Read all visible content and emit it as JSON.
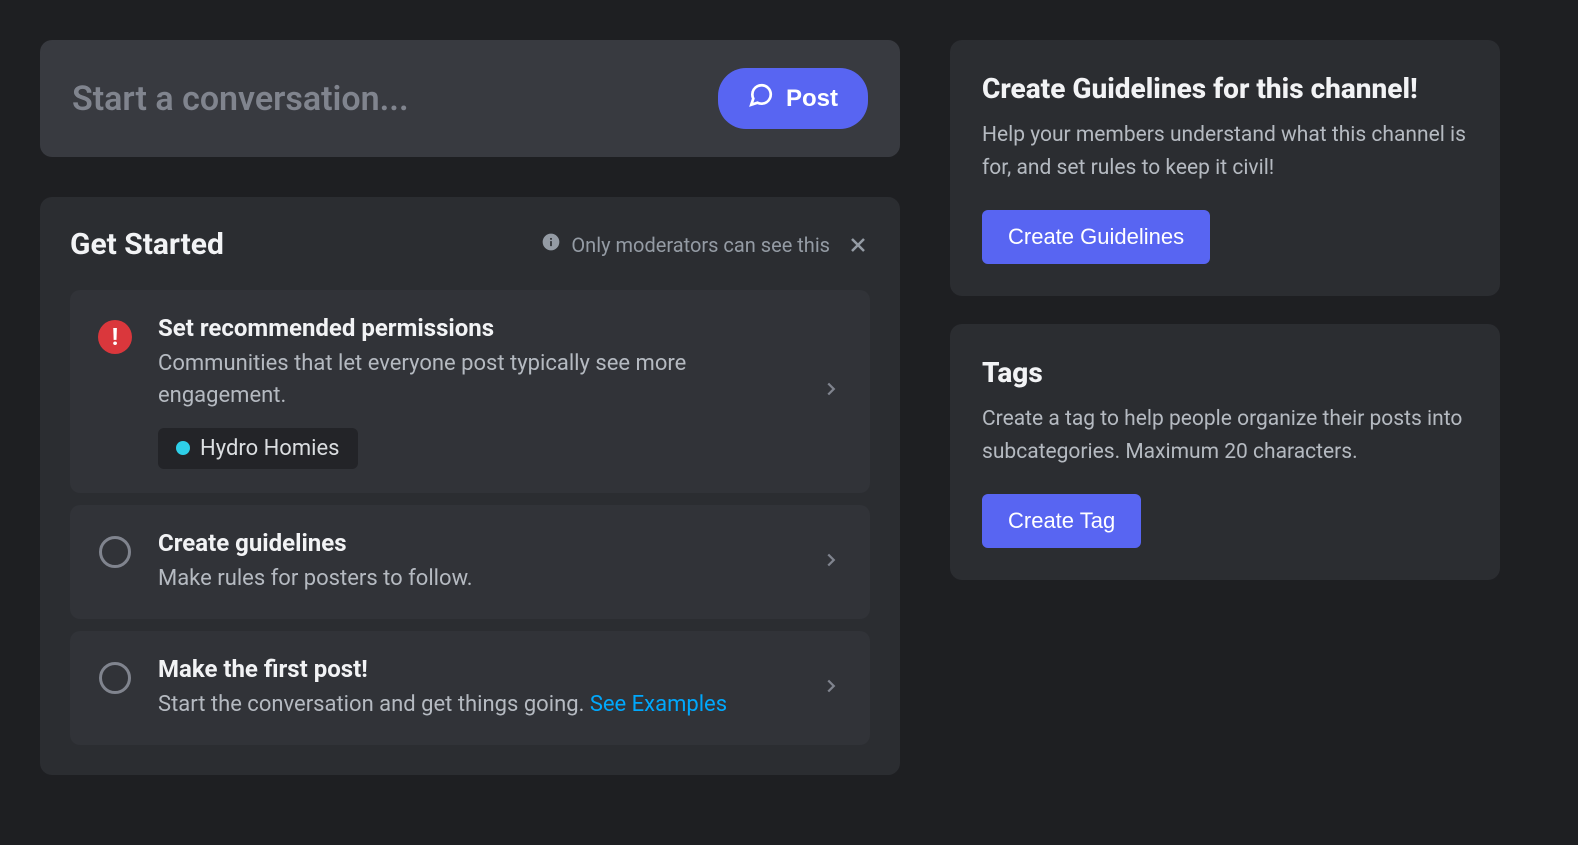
{
  "composer": {
    "placeholder": "Start a conversation...",
    "post_label": "Post"
  },
  "get_started": {
    "title": "Get Started",
    "moderator_notice": "Only moderators can see this",
    "steps": [
      {
        "title": "Set recommended permissions",
        "desc": "Communities that let everyone post typically see more engagement.",
        "role_chip": "Hydro Homies",
        "icon": "alert"
      },
      {
        "title": "Create guidelines",
        "desc": "Make rules for posters to follow.",
        "icon": "empty"
      },
      {
        "title": "Make the first post!",
        "desc": "Start the conversation and get things going. ",
        "link_text": "See Examples",
        "icon": "empty"
      }
    ]
  },
  "sidebar": {
    "guidelines": {
      "title": "Create Guidelines for this channel!",
      "desc": "Help your members understand what this channel is for, and set rules to keep it civil!",
      "button_label": "Create Guidelines"
    },
    "tags": {
      "title": "Tags",
      "desc": "Create a tag to help people organize their posts into subcategories. Maximum 20 characters.",
      "button_label": "Create Tag"
    }
  }
}
